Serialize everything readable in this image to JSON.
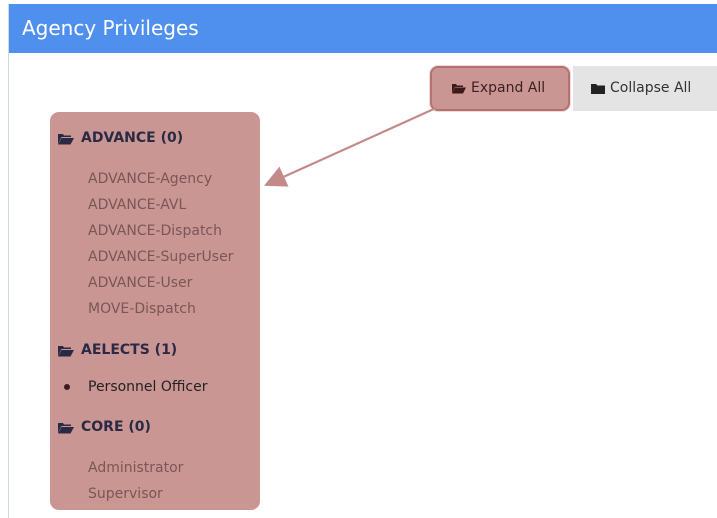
{
  "header": {
    "title": "Agency Privileges"
  },
  "toolbar": {
    "expand_label": "Expand All",
    "collapse_label": "Collapse All"
  },
  "tree": {
    "groups": [
      {
        "label": "ADVANCE (0)",
        "items": [
          "ADVANCE-Agency",
          "ADVANCE-AVL",
          "ADVANCE-Dispatch",
          "ADVANCE-SuperUser",
          "ADVANCE-User",
          "MOVE-Dispatch"
        ]
      },
      {
        "label": "AELECTS (1)",
        "items": [
          "Personnel Officer"
        ]
      },
      {
        "label": "CORE (0)",
        "items": [
          "Administrator",
          "Supervisor"
        ]
      }
    ]
  },
  "colors": {
    "header_bg": "#4f90ee",
    "highlight": "#c99694",
    "arrow": "#c48a8a"
  },
  "icons": {
    "expand": "folder-open-icon",
    "collapse": "folder-closed-icon",
    "group": "folder-open-icon"
  }
}
